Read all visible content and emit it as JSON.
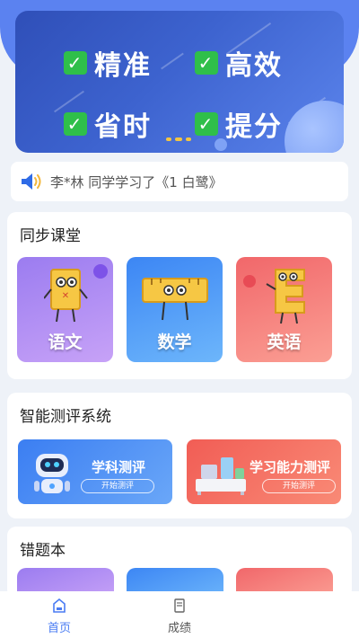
{
  "banner": {
    "slogans": [
      "精准",
      "高效",
      "省时",
      "提分"
    ]
  },
  "notice": {
    "text": "李*林 同学学习了《1 白鹭》"
  },
  "sync_class": {
    "title": "同步课堂",
    "subjects": [
      {
        "label": "语文",
        "color": "#b38cf2"
      },
      {
        "label": "数学",
        "color": "#4d9cf7"
      },
      {
        "label": "英语",
        "color": "#f77f7a"
      }
    ]
  },
  "smart_eval": {
    "title": "智能测评系统",
    "items": [
      {
        "title": "学科测评",
        "button": "开始测评",
        "color": "#4f8ff5"
      },
      {
        "title": "学习能力测评",
        "button": "开始测评",
        "color": "#f46b60"
      }
    ]
  },
  "wrong_book": {
    "title": "错题本"
  },
  "tabbar": {
    "home": "首页",
    "grades": "成绩"
  },
  "colors": {
    "accent": "#4a7cf3",
    "check_green": "#2fbf4a",
    "banner_dark": "#2f4fb8"
  }
}
